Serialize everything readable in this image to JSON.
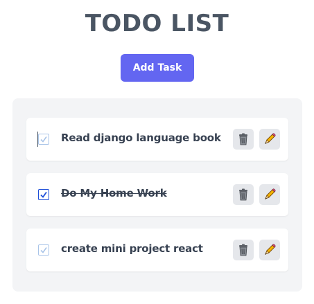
{
  "header": {
    "title": "TODO LIST"
  },
  "toolbar": {
    "add_label": "Add Task"
  },
  "tasks": [
    {
      "text": "Read django language book",
      "completed": false
    },
    {
      "text": "Do My Home Work",
      "completed": true
    },
    {
      "text": "create mini project react",
      "completed": false
    }
  ],
  "icons": {
    "delete": "trash-can-icon",
    "edit": "pencil-icon"
  },
  "colors": {
    "accent": "#6366f1",
    "title": "#4a5563",
    "panel": "#f3f4f6",
    "checked": "#1d4ed8",
    "unchecked": "#a9c4e8"
  }
}
